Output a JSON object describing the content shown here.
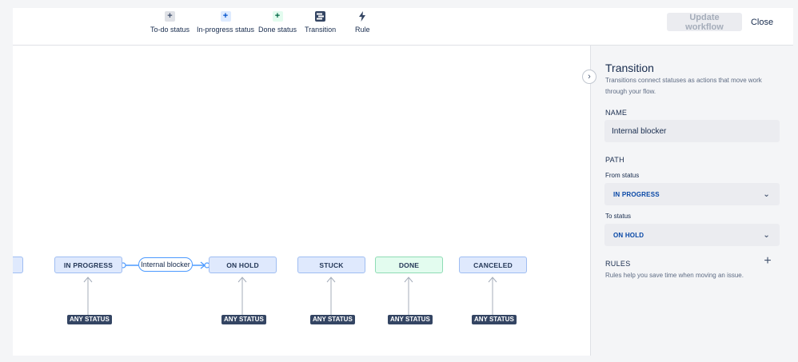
{
  "toolbar": {
    "tools": [
      {
        "label": "To-do status",
        "icon": "+",
        "icon_name": "plus-icon",
        "icon_bg": "#dfe1e6",
        "icon_color": "#42526e"
      },
      {
        "label": "In-progress status",
        "icon": "+",
        "icon_name": "plus-icon",
        "icon_bg": "#deebff",
        "icon_color": "#0052cc"
      },
      {
        "label": "Done status",
        "icon": "+",
        "icon_name": "plus-icon",
        "icon_bg": "#e3fcef",
        "icon_color": "#006644"
      },
      {
        "label": "Transition",
        "icon_name": "transition-icon"
      },
      {
        "label": "Rule",
        "icon_name": "lightning-icon"
      }
    ],
    "update_label": "Update workflow",
    "close_label": "Close"
  },
  "canvas": {
    "statuses": [
      {
        "label": "IN PROGRESS",
        "color": "blue"
      },
      {
        "label": "ON HOLD",
        "color": "blue"
      },
      {
        "label": "STUCK",
        "color": "blue"
      },
      {
        "label": "DONE",
        "color": "green"
      },
      {
        "label": "CANCELED",
        "color": "blue"
      }
    ],
    "transition_label": "Internal blocker",
    "any_status_label": "ANY STATUS"
  },
  "panel": {
    "title": "Transition",
    "description": "Transitions connect statuses as actions that move work through your flow.",
    "name_heading": "NAME",
    "name_value": "Internal blocker",
    "path_heading": "PATH",
    "from_label": "From status",
    "from_value": "IN PROGRESS",
    "to_label": "To status",
    "to_value": "ON HOLD",
    "rules_heading": "RULES",
    "rules_description": "Rules help you save time when moving an issue."
  },
  "colors": {
    "accent": "#4c9aff",
    "status_blue_bg": "#dfe9fd",
    "status_green_bg": "#e3fcef",
    "badge_dark": "#344563"
  }
}
